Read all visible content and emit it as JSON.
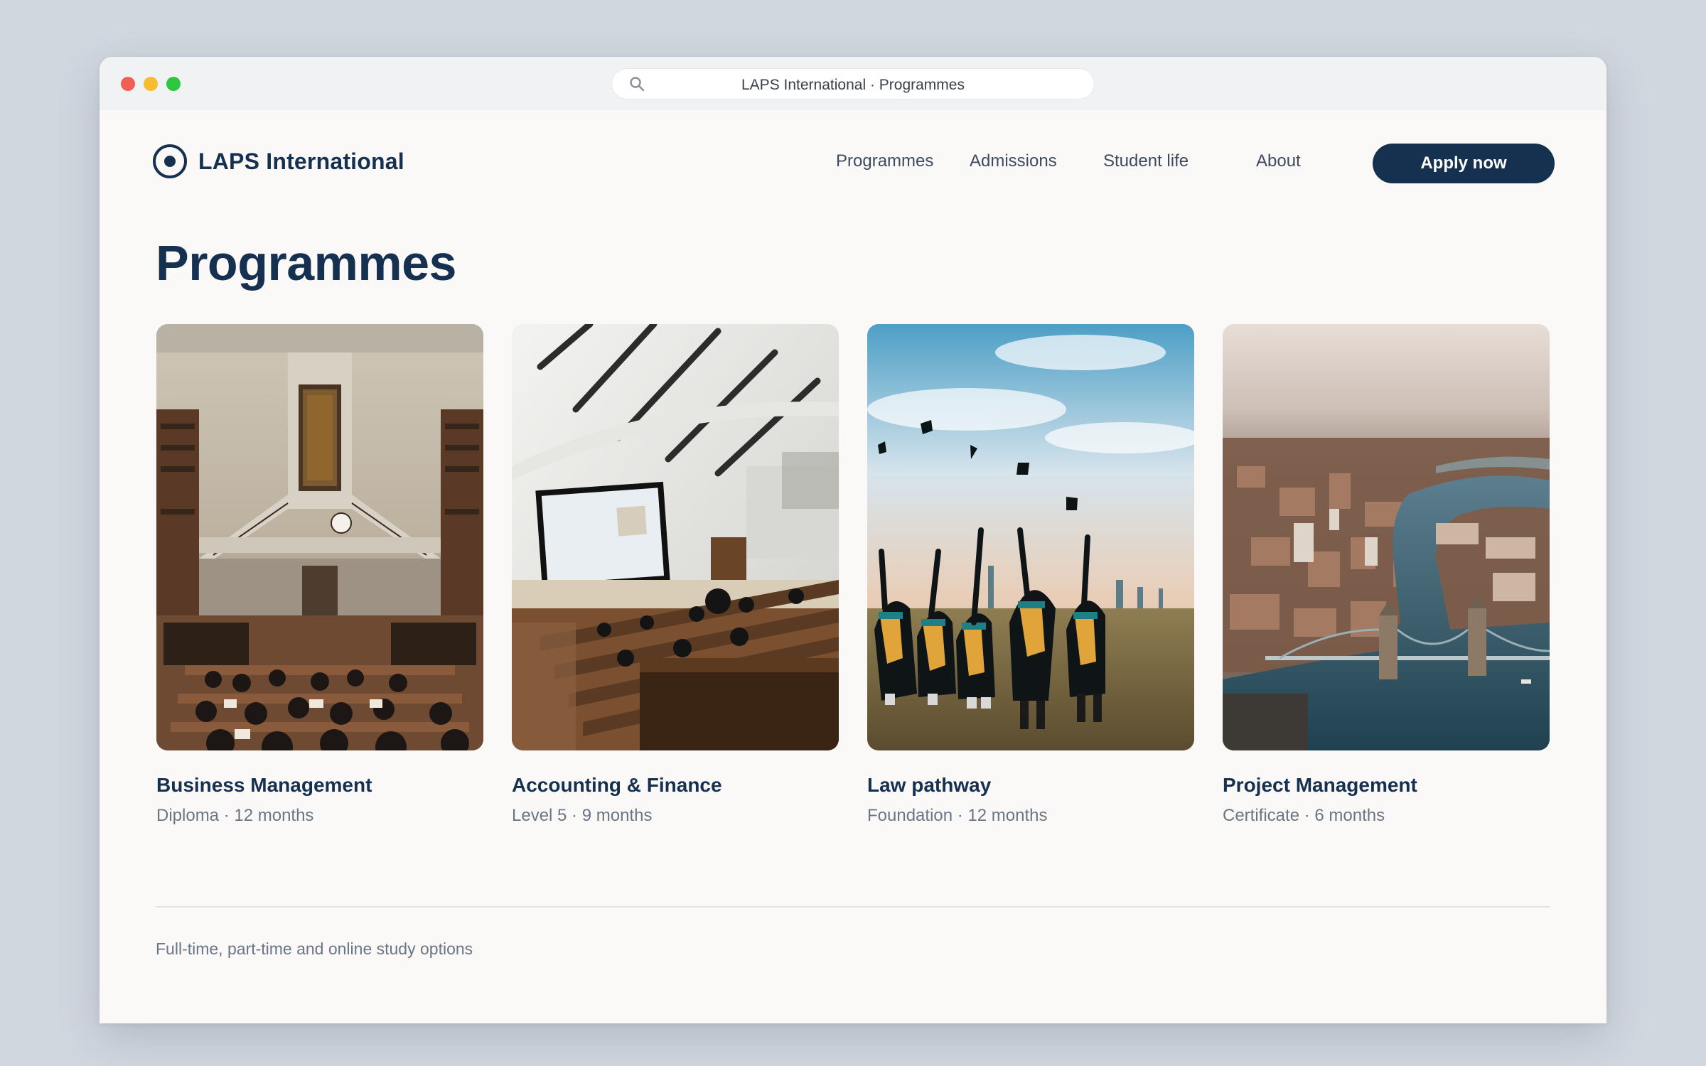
{
  "browser": {
    "url_text": "LAPS International · Programmes"
  },
  "header": {
    "brand": "LAPS International",
    "nav": [
      "Programmes",
      "Admissions",
      "Student life",
      "About"
    ],
    "cta": "Apply now"
  },
  "main": {
    "title": "Programmes",
    "cards": [
      {
        "title": "Business Management",
        "meta": "Diploma · 12 months",
        "image": "library-hall-photo"
      },
      {
        "title": "Accounting & Finance",
        "meta": "Level 5 · 9 months",
        "image": "lecture-theatre-photo"
      },
      {
        "title": "Law pathway",
        "meta": "Foundation · 12 months",
        "image": "graduation-caps-photo"
      },
      {
        "title": "Project Management",
        "meta": "Certificate · 6 months",
        "image": "city-river-aerial-photo"
      }
    ]
  },
  "footer": {
    "note": "Full-time, part-time and online study options"
  },
  "colors": {
    "brand": "#16304f",
    "background": "#faf9f7",
    "muted": "#6b7685"
  }
}
